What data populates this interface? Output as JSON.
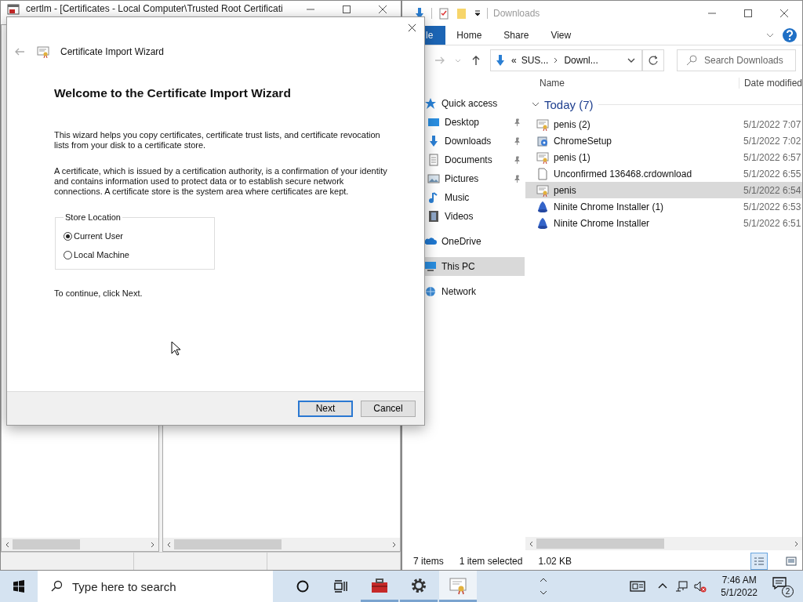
{
  "background_window": {
    "title": "certlm - [Certificates - Local Computer\\Trusted Root Certificati"
  },
  "wizard": {
    "title": "Certificate Import Wizard",
    "heading": "Welcome to the Certificate Import Wizard",
    "paragraphs": [
      "This wizard helps you copy certificates, certificate trust lists, and certificate revocation lists from your disk to a certificate store.",
      "A certificate, which is issued by a certification authority, is a confirmation of your identity and contains information used to protect data or to establish secure network connections. A certificate store is the system area where certificates are kept."
    ],
    "store_location": {
      "label": "Store Location",
      "options": [
        {
          "label": "Current User",
          "selected": true
        },
        {
          "label": "Local Machine",
          "selected": false
        }
      ]
    },
    "hint": "To continue, click Next.",
    "buttons": [
      {
        "label": "Next",
        "focused": true
      },
      {
        "label": "Cancel",
        "focused": false
      }
    ]
  },
  "explorer": {
    "title": "Downloads",
    "ribbon_tabs": [
      {
        "label": "le",
        "kind": "file"
      },
      {
        "label": "Home",
        "kind": "tab"
      },
      {
        "label": "Share",
        "kind": "tab"
      },
      {
        "label": "View",
        "kind": "tab"
      }
    ],
    "address": {
      "prefix": "«",
      "parts": [
        "SUS...",
        "Downl..."
      ]
    },
    "search": {
      "placeholder": "Search Downloads"
    },
    "columns": [
      "Name",
      "Date modified"
    ],
    "nav": [
      {
        "label": "Quick access",
        "kind": "star",
        "pinned": false,
        "selected": false,
        "top": true
      },
      {
        "label": "Desktop",
        "kind": "desktop",
        "pinned": true,
        "selected": false,
        "top": false
      },
      {
        "label": "Downloads",
        "kind": "downloads",
        "pinned": true,
        "selected": false,
        "top": false
      },
      {
        "label": "Documents",
        "kind": "documents",
        "pinned": true,
        "selected": false,
        "top": false
      },
      {
        "label": "Pictures",
        "kind": "pictures",
        "pinned": true,
        "selected": false,
        "top": false
      },
      {
        "label": "Music",
        "kind": "music",
        "pinned": false,
        "selected": false,
        "top": false
      },
      {
        "label": "Videos",
        "kind": "videos",
        "pinned": false,
        "selected": false,
        "top": false
      },
      {
        "label": "OneDrive",
        "kind": "cloud",
        "pinned": false,
        "selected": false,
        "top": true
      },
      {
        "label": "This PC",
        "kind": "pc",
        "pinned": false,
        "selected": true,
        "top": true
      },
      {
        "label": "Network",
        "kind": "network",
        "pinned": false,
        "selected": false,
        "top": true
      }
    ],
    "group": {
      "label": "Today (7)",
      "expanded": true
    },
    "files": [
      {
        "name": "penis (2)",
        "date": "5/1/2022 7:07",
        "kind": "certificate",
        "selected": false
      },
      {
        "name": "ChromeSetup",
        "date": "5/1/2022 7:02",
        "kind": "setup",
        "selected": false
      },
      {
        "name": "penis (1)",
        "date": "5/1/2022 6:57",
        "kind": "certificate",
        "selected": false
      },
      {
        "name": "Unconfirmed 136468.crdownload",
        "date": "5/1/2022 6:55",
        "kind": "document",
        "selected": false
      },
      {
        "name": "penis",
        "date": "5/1/2022 6:54",
        "kind": "certificate",
        "selected": true
      },
      {
        "name": "Ninite Chrome Installer (1)",
        "date": "5/1/2022 6:53",
        "kind": "ninite",
        "selected": false
      },
      {
        "name": "Ninite Chrome Installer",
        "date": "5/1/2022 6:51",
        "kind": "ninite",
        "selected": false
      }
    ],
    "status": [
      "7 items",
      "1 item selected",
      "1.02 KB"
    ]
  },
  "taskbar": {
    "search_placeholder": "Type here to search",
    "apps": [
      {
        "kind": "toolbox",
        "active": false
      },
      {
        "kind": "gear",
        "active": false
      },
      {
        "kind": "certificate",
        "active": true
      }
    ],
    "time": "7:46 AM",
    "date": "5/1/2022",
    "notifications": "2"
  }
}
